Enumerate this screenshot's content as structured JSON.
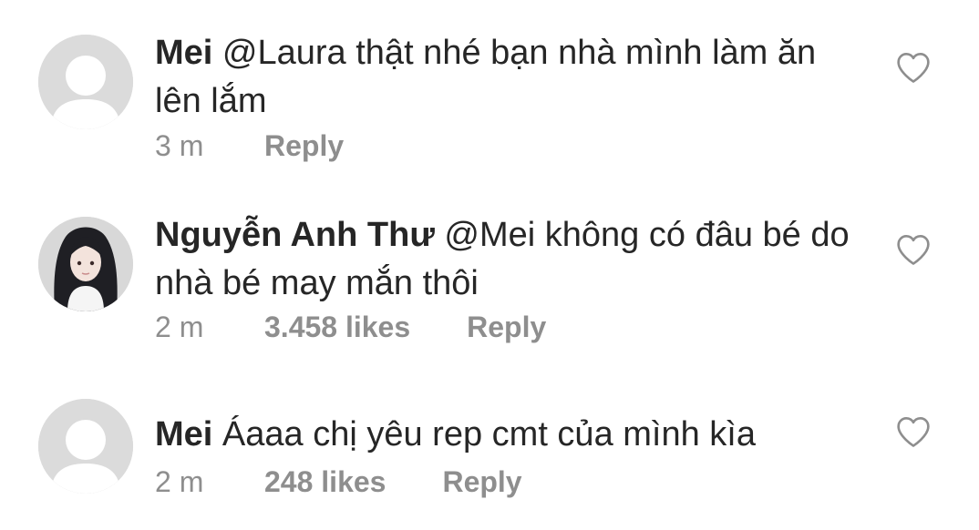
{
  "comments": [
    {
      "username": "Mei",
      "text": "@Laura thật nhé bạn nhà mình làm ăn lên lắm",
      "time": "3 m",
      "likes": "",
      "reply_label": "Reply",
      "avatar": "default-avatar"
    },
    {
      "username": "Nguyễn Anh Thư",
      "text": "@Mei không có đâu bé do nhà bé may mắn thôi",
      "time": "2 m",
      "likes": "3.458 likes",
      "reply_label": "Reply",
      "avatar": "profile-photo"
    },
    {
      "username": "Mei",
      "text": "Áaaa chị yêu rep cmt của mình kìa",
      "time": "2 m",
      "likes": "248 likes",
      "reply_label": "Reply",
      "avatar": "default-avatar"
    }
  ],
  "icons": {
    "like": "heart-outline-icon"
  },
  "colors": {
    "text": "#262626",
    "meta": "#8e8e8e",
    "avatar_bg": "#dbdbdb"
  }
}
